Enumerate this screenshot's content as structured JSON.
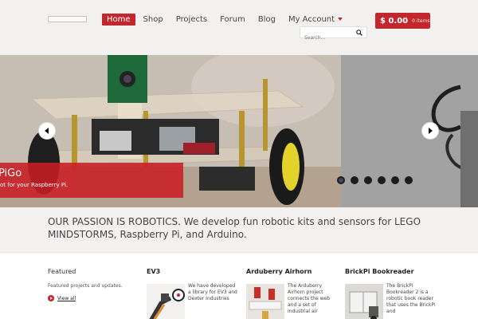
{
  "nav": {
    "items": [
      {
        "label": "Home",
        "active": true
      },
      {
        "label": "Shop"
      },
      {
        "label": "Projects"
      },
      {
        "label": "Forum"
      },
      {
        "label": "Blog"
      },
      {
        "label": "My Account",
        "dropdown": true
      }
    ]
  },
  "cart": {
    "amount": "$ 0.00",
    "items": "0 items"
  },
  "search": {
    "placeholder": "Search..."
  },
  "slider": {
    "caption_title": "GoPiGo",
    "caption_title_visible": "PiGo",
    "caption_sub": "ot for your Raspberry Pi.",
    "dot_count": 6,
    "active_dot": 0
  },
  "tagline": "OUR PASSION IS ROBOTICS. We develop fun robotic kits and sensors for LEGO MINDSTORMS, Raspberry Pi, and Arduino.",
  "featured": {
    "title": "Featured",
    "description": "Featured projects and updates.",
    "view_all": "View all"
  },
  "cards": [
    {
      "title": "EV3",
      "text": "We have developed a library for EV3 and Dexter Industries"
    },
    {
      "title": "Arduberry Airhorn",
      "text": "The Arduberry Airhorn project connects the web and a set of industrial air"
    },
    {
      "title": "BrickPi Bookreader",
      "text": "The BrickPi Bookreader 2 is a robotic book reader that uses the BrickPi and"
    }
  ],
  "colors": {
    "accent": "#c2272d",
    "background": "#f3f0f0"
  }
}
